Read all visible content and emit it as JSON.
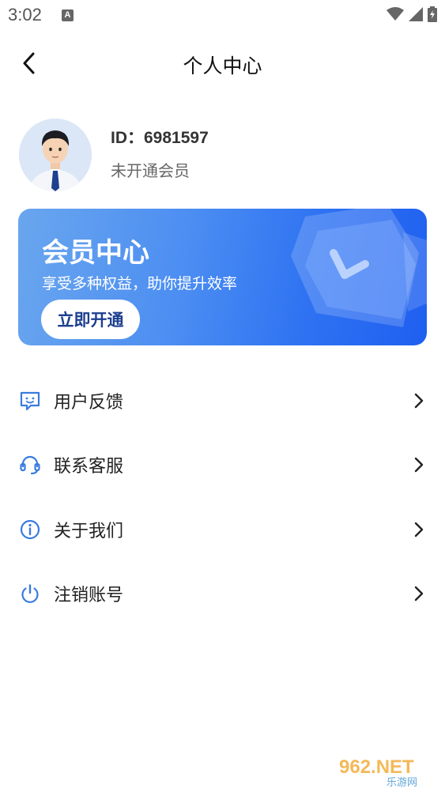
{
  "status_bar": {
    "time": "3:02",
    "a_icon": "A"
  },
  "header": {
    "title": "个人中心"
  },
  "profile": {
    "user_id": "ID：6981597",
    "member_status": "未开通会员"
  },
  "vip_card": {
    "title": "会员中心",
    "subtitle": "享受多种权益，助你提升效率",
    "button_label": "立即开通"
  },
  "menu": {
    "items": [
      {
        "label": "用户反馈",
        "icon": "feedback-icon"
      },
      {
        "label": "联系客服",
        "icon": "headset-icon"
      },
      {
        "label": "关于我们",
        "icon": "info-icon"
      },
      {
        "label": "注销账号",
        "icon": "power-icon"
      }
    ]
  },
  "watermark": {
    "text": "962.NET",
    "subtext": "乐游网"
  },
  "colors": {
    "accent": "#2f73f2",
    "icon_blue": "#3a7be0",
    "card_start": "#6aa6ee",
    "card_end": "#1f5ff0"
  }
}
